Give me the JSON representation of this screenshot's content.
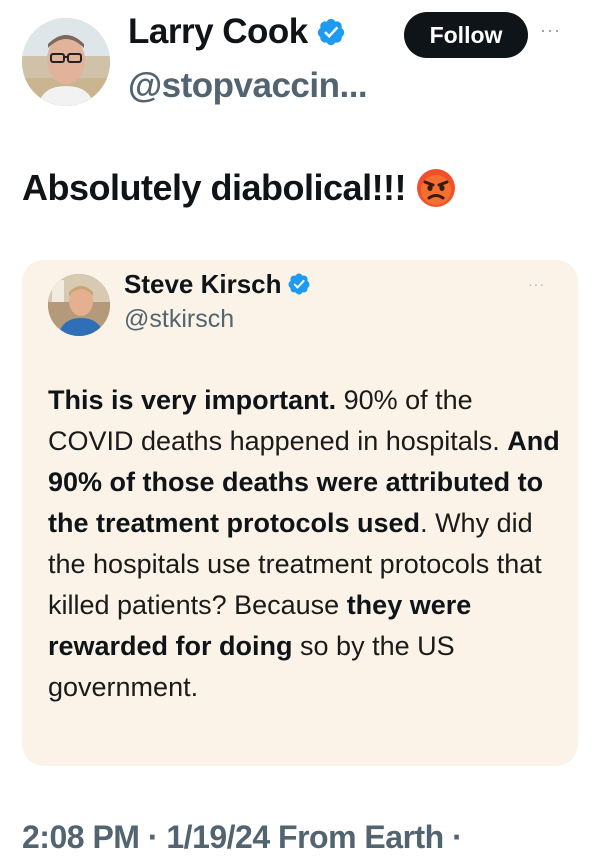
{
  "author": {
    "name": "Larry Cook",
    "handle": "@stopvaccin...",
    "follow_label": "Follow",
    "more_label": "···",
    "verified_color": "#1d9bf0"
  },
  "tweet": {
    "text": "Absolutely diabolical!!!",
    "emoji": "angry-face-emoji"
  },
  "quoted_tweet": {
    "name": "Steve Kirsch",
    "handle": "@stkirsch",
    "more_label": "···",
    "background": "#fbf3e7",
    "body": [
      {
        "text": "This is very important.",
        "bold": true
      },
      {
        "text": " 90% of the COVID deaths happened in hospitals. ",
        "bold": false
      },
      {
        "text": "And 90% of those deaths were attributed to the treatment protocols used",
        "bold": true
      },
      {
        "text": ". Why did the hospitals use treatment protocols that killed patients? Because ",
        "bold": false
      },
      {
        "text": "they were rewarded for doing",
        "bold": true
      },
      {
        "text": " so by the US government.",
        "bold": false
      }
    ]
  },
  "footer": {
    "meta": "2:08 PM · 1/19/24 From Earth ·"
  }
}
